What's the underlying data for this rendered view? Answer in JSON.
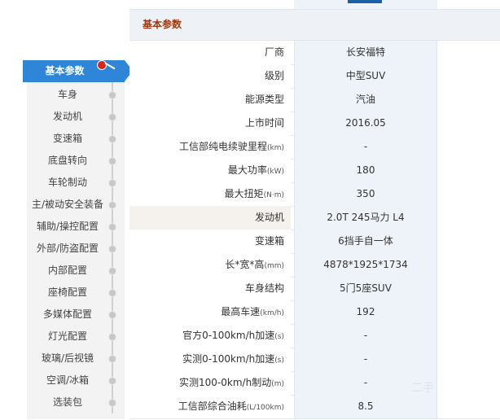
{
  "sidenav": {
    "active": "基本参数",
    "items": [
      "车身",
      "发动机",
      "变速箱",
      "底盘转向",
      "车轮制动",
      "主/被动安全装备",
      "辅助/操控配置",
      "外部/防盗配置",
      "内部配置",
      "座椅配置",
      "多媒体配置",
      "灯光配置",
      "玻璃/后视镜",
      "空调/冰箱",
      "选装包"
    ]
  },
  "table": {
    "section_title": "基本参数",
    "rows": [
      {
        "label": "厂商",
        "value": "长安福特"
      },
      {
        "label": "级别",
        "value": "中型SUV"
      },
      {
        "label": "能源类型",
        "value": "汽油"
      },
      {
        "label": "上市时间",
        "value": "2016.05"
      },
      {
        "label": "工信部纯电续驶里程",
        "unit": "(km)",
        "value": "-"
      },
      {
        "label": "最大功率",
        "unit": "(kW)",
        "value": "180"
      },
      {
        "label": "最大扭矩",
        "unit": "(N·m)",
        "value": "350"
      },
      {
        "label": "发动机",
        "value": "2.0T 245马力 L4",
        "highlight": true
      },
      {
        "label": "变速箱",
        "value": "6挡手自一体"
      },
      {
        "label": "长*宽*高",
        "unit": "(mm)",
        "value": "4878*1925*1734"
      },
      {
        "label": "车身结构",
        "value": "5门5座SUV"
      },
      {
        "label": "最高车速",
        "unit": "(km/h)",
        "value": "192"
      },
      {
        "label": "官方0-100km/h加速",
        "unit": "(s)",
        "value": "-"
      },
      {
        "label": "实测0-100km/h加速",
        "unit": "(s)",
        "value": "-"
      },
      {
        "label": "实测100-0km/h制动",
        "unit": "(m)",
        "value": "-"
      },
      {
        "label": "工信部综合油耗",
        "unit": "(L/100km)",
        "value": "8.5"
      }
    ]
  },
  "watermark": "二手"
}
